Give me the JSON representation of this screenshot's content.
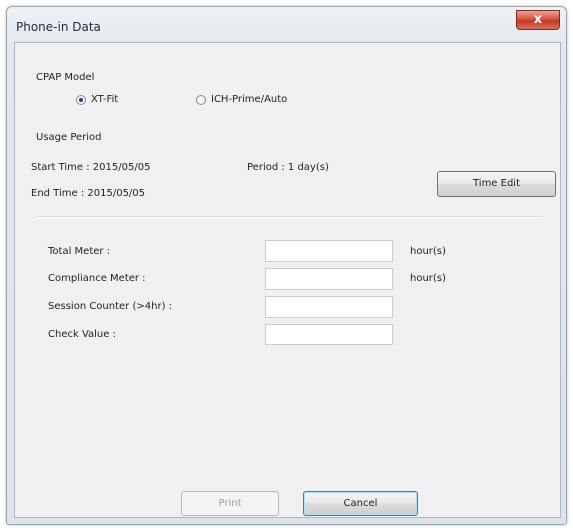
{
  "window": {
    "title": "Phone-in Data",
    "close_label": "x"
  },
  "cpap_model": {
    "label": "CPAP Model",
    "options": [
      {
        "label": "XT-Fit",
        "selected": true
      },
      {
        "label": "ICH-Prime/Auto",
        "selected": false
      }
    ]
  },
  "usage_period": {
    "label": "Usage Period",
    "start_time": "Start Time : 2015/05/05",
    "end_time": "End Time : 2015/05/05",
    "period": "Period : 1 day(s)",
    "time_edit_label": "Time Edit"
  },
  "fields": [
    {
      "label": "Total Meter :",
      "value": "",
      "unit": "hour(s)"
    },
    {
      "label": "Compliance Meter :",
      "value": "",
      "unit": "hour(s)"
    },
    {
      "label": "Session Counter (>4hr) :",
      "value": "",
      "unit": ""
    },
    {
      "label": "Check Value :",
      "value": "",
      "unit": ""
    }
  ],
  "footer": {
    "print_label": "Print",
    "cancel_label": "Cancel"
  }
}
